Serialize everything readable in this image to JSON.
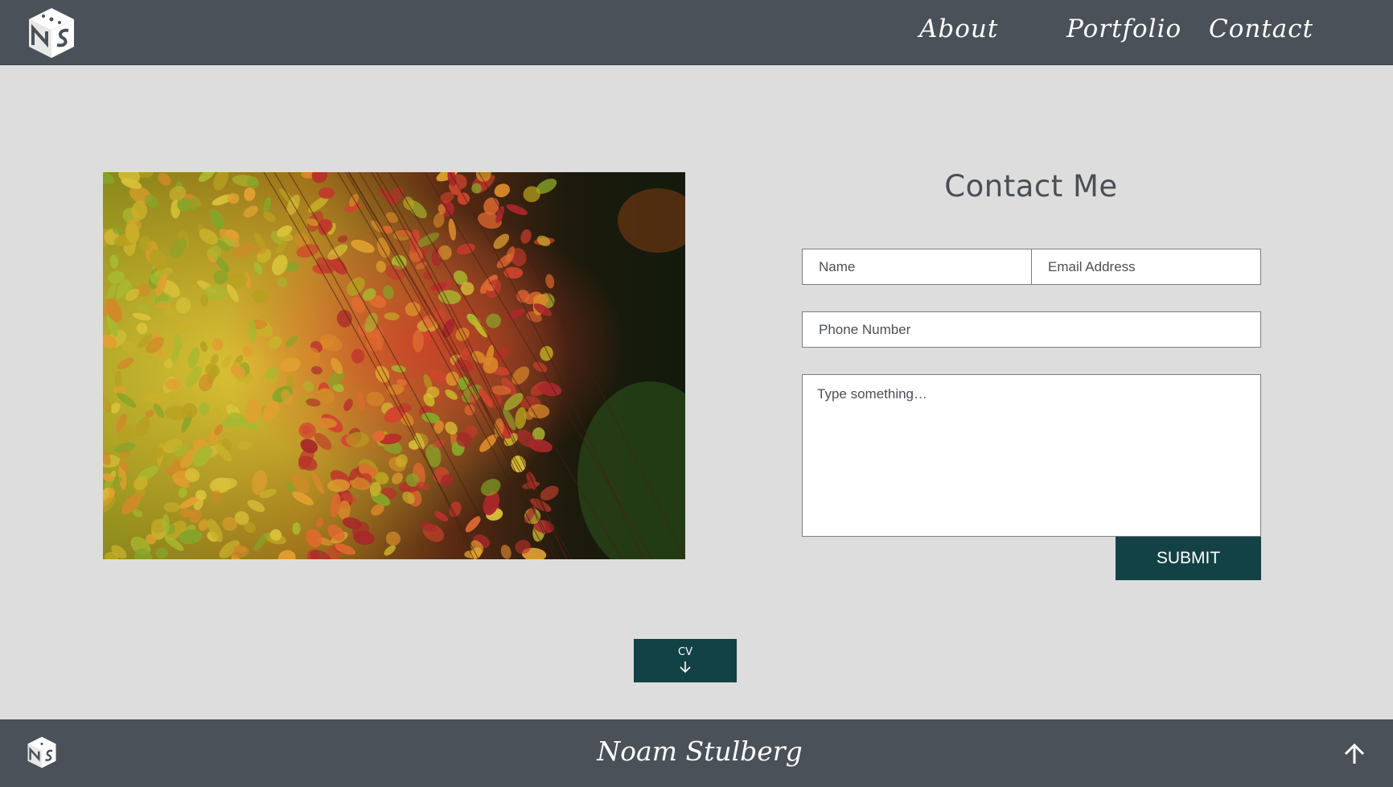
{
  "header": {
    "logo_icon": "ns-cube-logo",
    "nav": [
      "About",
      "Portfolio",
      "Contact"
    ]
  },
  "photo": {
    "description_icon": "autumn-leaves-photo"
  },
  "contact": {
    "title": "Contact Me",
    "name_placeholder": "Name",
    "email_placeholder": "Email Address",
    "phone_placeholder": "Phone Number",
    "message_placeholder": "Type something…",
    "submit_label": "SUBMIT"
  },
  "cv_button": {
    "label": "CV",
    "icon": "arrow-down-icon"
  },
  "footer": {
    "logo_icon": "ns-cube-logo",
    "name": "Noam Stulberg",
    "up_icon": "arrow-up-icon"
  },
  "colors": {
    "header_bg": "#4a5158",
    "page_bg": "#dddddd",
    "accent": "#134246"
  }
}
